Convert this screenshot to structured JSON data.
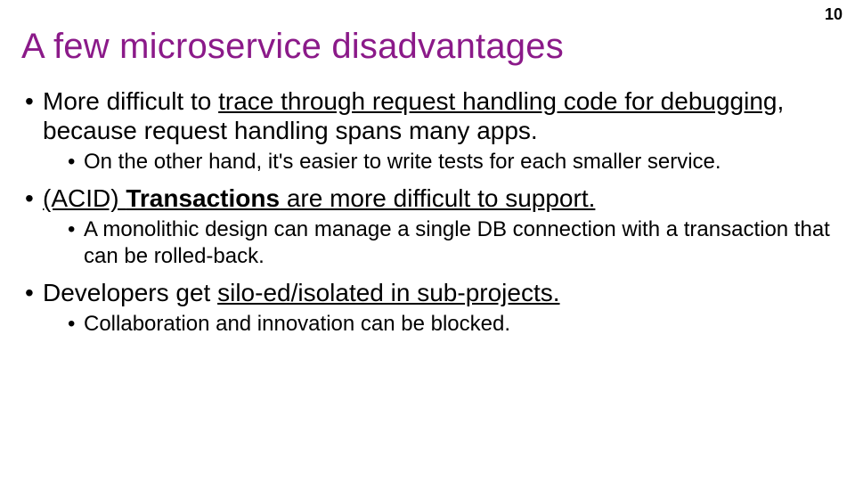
{
  "page_number": "10",
  "title": "A few microservice disadvantages",
  "bullets": [
    {
      "pre": "More difficult to ",
      "underlined": "trace through request handling code for debugging",
      "post": ", because request handling spans many apps.",
      "sub": "On the other hand, it's easier to write tests for each smaller service."
    },
    {
      "pre": "(ACID) ",
      "bold": "Transactions",
      "post_underlined": " are more difficult to support.",
      "sub": "A monolithic design can manage a single DB connection with a transaction that can be rolled-back."
    },
    {
      "pre": "Developers get ",
      "underlined": "silo-ed/isolated in sub-projects.",
      "post": "",
      "sub": "Collaboration and innovation can be blocked."
    }
  ]
}
